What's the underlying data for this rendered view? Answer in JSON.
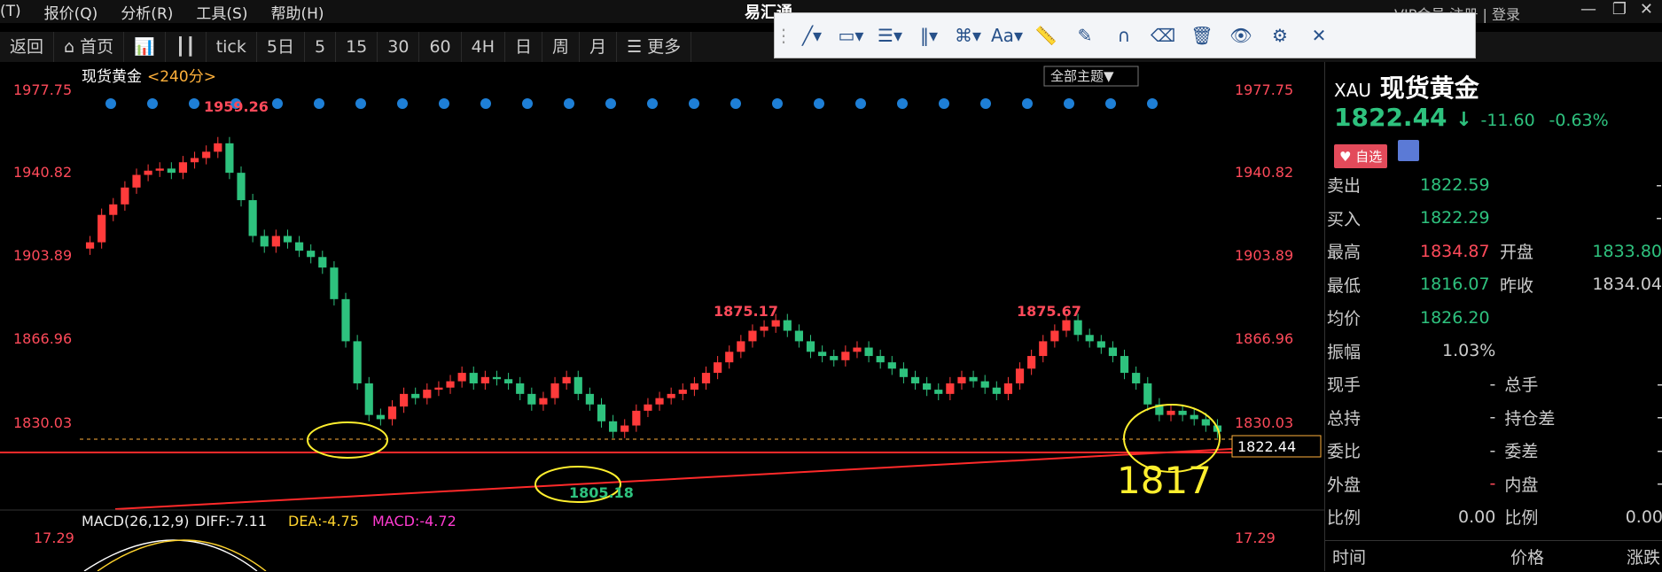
{
  "menu": {
    "items": [
      "(T)",
      "报价(Q)",
      "分析(R)",
      "工具(S)",
      "帮助(H)"
    ],
    "app_name": "易汇通",
    "right_text": "VIP会员  注册  |  登录"
  },
  "toolbar": {
    "items": [
      "返回",
      "首页",
      "tick",
      "5日",
      "5",
      "15",
      "30",
      "60",
      "4H",
      "日",
      "周",
      "月",
      "更多"
    ]
  },
  "drawtools": {
    "icons": [
      "line-icon",
      "rect-icon",
      "fib-icon",
      "bars-icon",
      "pattern-icon",
      "text-icon",
      "ruler-icon",
      "pen-icon",
      "magnet-icon",
      "eraser-icon",
      "trash-icon",
      "eye-icon",
      "gear-icon",
      "close-icon"
    ],
    "text_label": "Aa"
  },
  "chart": {
    "instrument": "现货黄金",
    "period": "<240分>",
    "theme_btn": "全部主题▼",
    "y_left": [
      "1977.75",
      "1940.82",
      "1903.89",
      "1866.96",
      "1830.03"
    ],
    "y_right": [
      "1977.75",
      "1940.82",
      "1903.89",
      "1866.96",
      "1830.03"
    ],
    "current_price_box": "1822.44",
    "annotations": [
      "1959.26",
      "1875.17",
      "1875.67",
      "1805.18",
      "1817"
    ],
    "macd_label": "MACD(26,12,9)",
    "diff_label": "DIFF:-7.11",
    "dea_label": "DEA:-4.75",
    "macd_val": "MACD:-4.72",
    "macd_tick": "17.29",
    "highlight_color": "#ffef2e",
    "up_color": "#ff3b3b",
    "down_color": "#2ec27e"
  },
  "chart_data": {
    "type": "candlestick",
    "title": "现货黄金 <240分>",
    "ylim": [
      1800,
      1985
    ],
    "y_ticks": [
      1977.75,
      1940.82,
      1903.89,
      1866.96,
      1830.03
    ],
    "closes": [
      1912,
      1925,
      1930,
      1938,
      1944,
      1946,
      1947,
      1945,
      1950,
      1952,
      1955,
      1959,
      1945,
      1932,
      1915,
      1910,
      1915,
      1912,
      1908,
      1905,
      1900,
      1885,
      1865,
      1845,
      1830,
      1828,
      1834,
      1840,
      1838,
      1842,
      1843,
      1846,
      1850,
      1845,
      1848,
      1847,
      1845,
      1840,
      1835,
      1838,
      1845,
      1848,
      1840,
      1835,
      1827,
      1822,
      1825,
      1832,
      1835,
      1838,
      1840,
      1842,
      1845,
      1850,
      1855,
      1860,
      1865,
      1870,
      1872,
      1875,
      1870,
      1865,
      1860,
      1858,
      1856,
      1860,
      1862,
      1858,
      1855,
      1852,
      1848,
      1845,
      1842,
      1840,
      1845,
      1848,
      1846,
      1843,
      1840,
      1845,
      1852,
      1858,
      1865,
      1870,
      1875,
      1868,
      1865,
      1862,
      1858,
      1850,
      1845,
      1835,
      1830,
      1832,
      1830,
      1828,
      1825,
      1822
    ],
    "marked_high_1": 1959.26,
    "marked_high_2": 1875.17,
    "marked_high_3": 1875.67,
    "marked_low": 1805.18,
    "current": 1822.44
  },
  "quote": {
    "code": "XAU",
    "name": "现货黄金",
    "price": "1822.44",
    "arrow": "↓",
    "change": "-11.60",
    "pct": "-0.63%",
    "fav_label": "自选",
    "rows": [
      {
        "k1": "卖出",
        "v1": "1822.59",
        "k2": "",
        "v2": "-"
      },
      {
        "k1": "买入",
        "v1": "1822.29",
        "k2": "",
        "v2": "-"
      },
      {
        "k1": "最高",
        "v1": "1834.87",
        "k2": "开盘",
        "v2": "1833.80"
      },
      {
        "k1": "最低",
        "v1": "1816.07",
        "k2": "昨收",
        "v2": "1834.04"
      },
      {
        "k1": "均价",
        "v1": "1826.20",
        "k2": "",
        "v2": ""
      },
      {
        "k1": "振幅",
        "v1": "1.03%",
        "k2": "",
        "v2": ""
      },
      {
        "k1": "现手",
        "v1": "-",
        "k2": "总手",
        "v2": "-"
      },
      {
        "k1": "总持",
        "v1": "-",
        "k2": "持仓差",
        "v2": "-"
      },
      {
        "k1": "委比",
        "v1": "-",
        "k2": "委差",
        "v2": "-"
      },
      {
        "k1": "外盘",
        "v1": "-",
        "k2": "内盘",
        "v2": "-"
      },
      {
        "k1": "比例",
        "v1": "0.00",
        "k2": "比例",
        "v2": "0.00"
      }
    ],
    "footer": {
      "time": "时间",
      "price": "价格",
      "change": "涨跌"
    }
  }
}
